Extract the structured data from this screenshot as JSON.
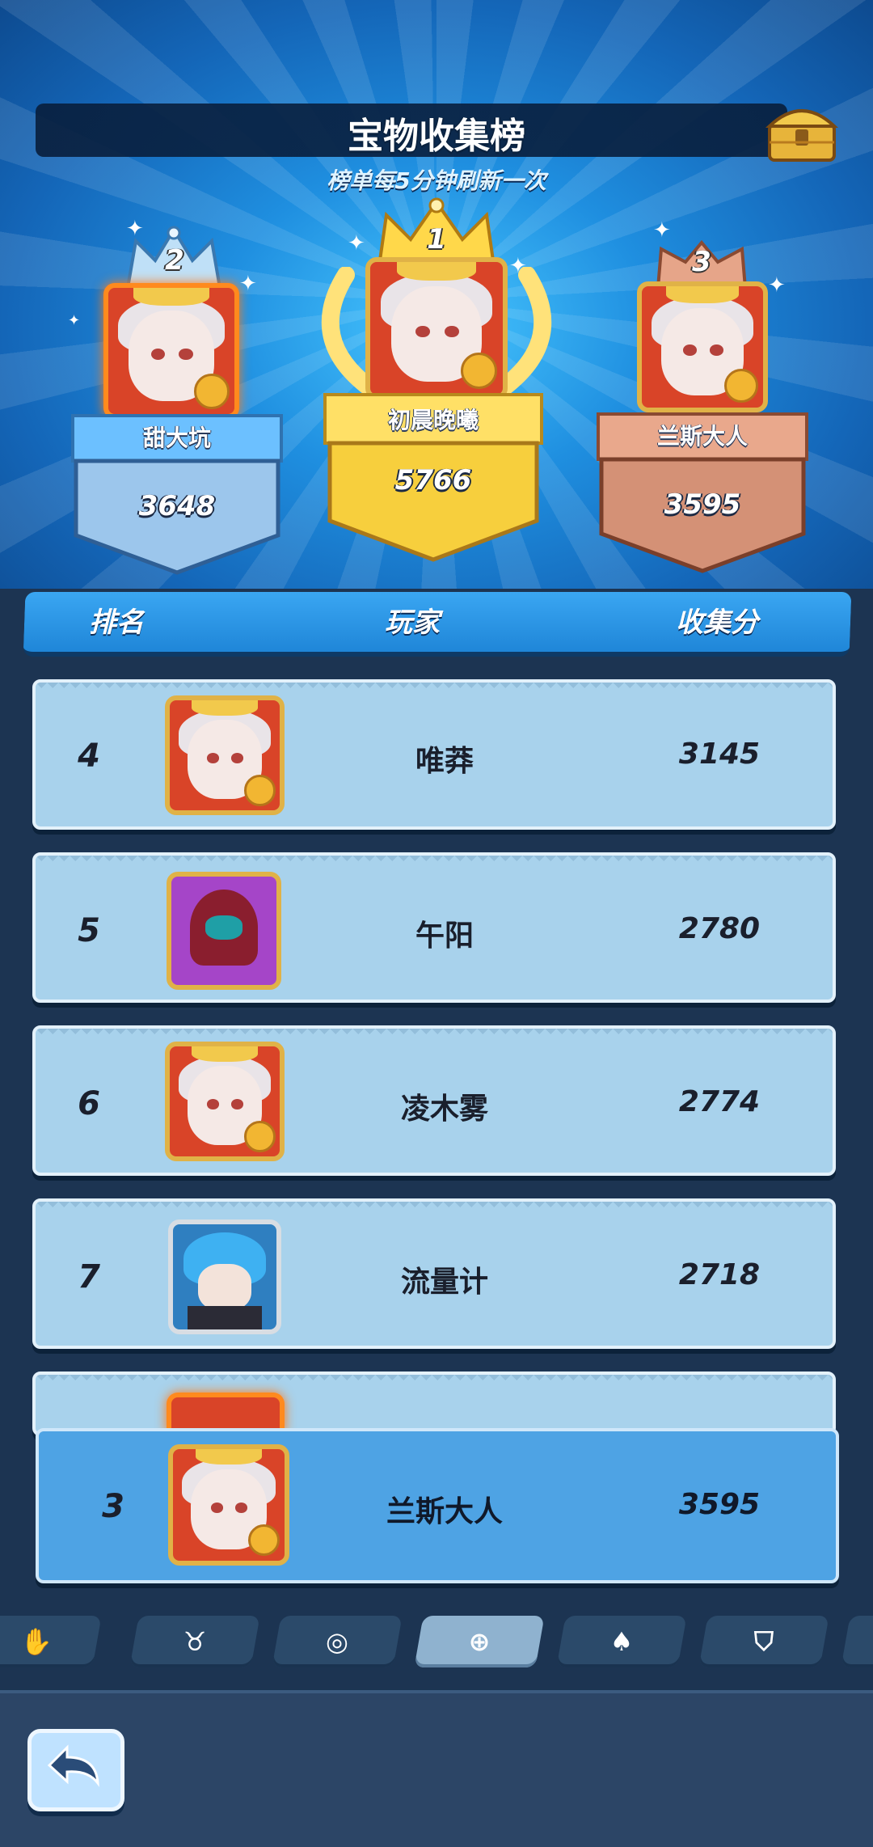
{
  "header": {
    "title": "宝物收集榜",
    "subtitle": "榜单每5分钟刷新一次"
  },
  "podium": [
    {
      "rank": "2",
      "name": "甜大坑",
      "score": "3648"
    },
    {
      "rank": "1",
      "name": "初晨晚曦",
      "score": "5766"
    },
    {
      "rank": "3",
      "name": "兰斯大人",
      "score": "3595"
    }
  ],
  "table_header": {
    "rank": "排名",
    "player": "玩家",
    "score": "收集分"
  },
  "rows": [
    {
      "rank": "4",
      "name": "唯莽",
      "score": "3145"
    },
    {
      "rank": "5",
      "name": "午阳",
      "score": "2780"
    },
    {
      "rank": "6",
      "name": "凌木雾",
      "score": "2774"
    },
    {
      "rank": "7",
      "name": "流量计",
      "score": "2718"
    }
  ],
  "my_rank": {
    "rank": "3",
    "name": "兰斯大人",
    "score": "3595"
  },
  "tabs": [
    "hand-icon",
    "bull-icon",
    "spiral-icon",
    "plus-icon",
    "card-icon",
    "shield-icon"
  ],
  "colors": {
    "gold": "#f6c93a",
    "silver_blue": "#6fb8f2",
    "bronze": "#c98566",
    "accent_blue": "#2a8fe0"
  }
}
